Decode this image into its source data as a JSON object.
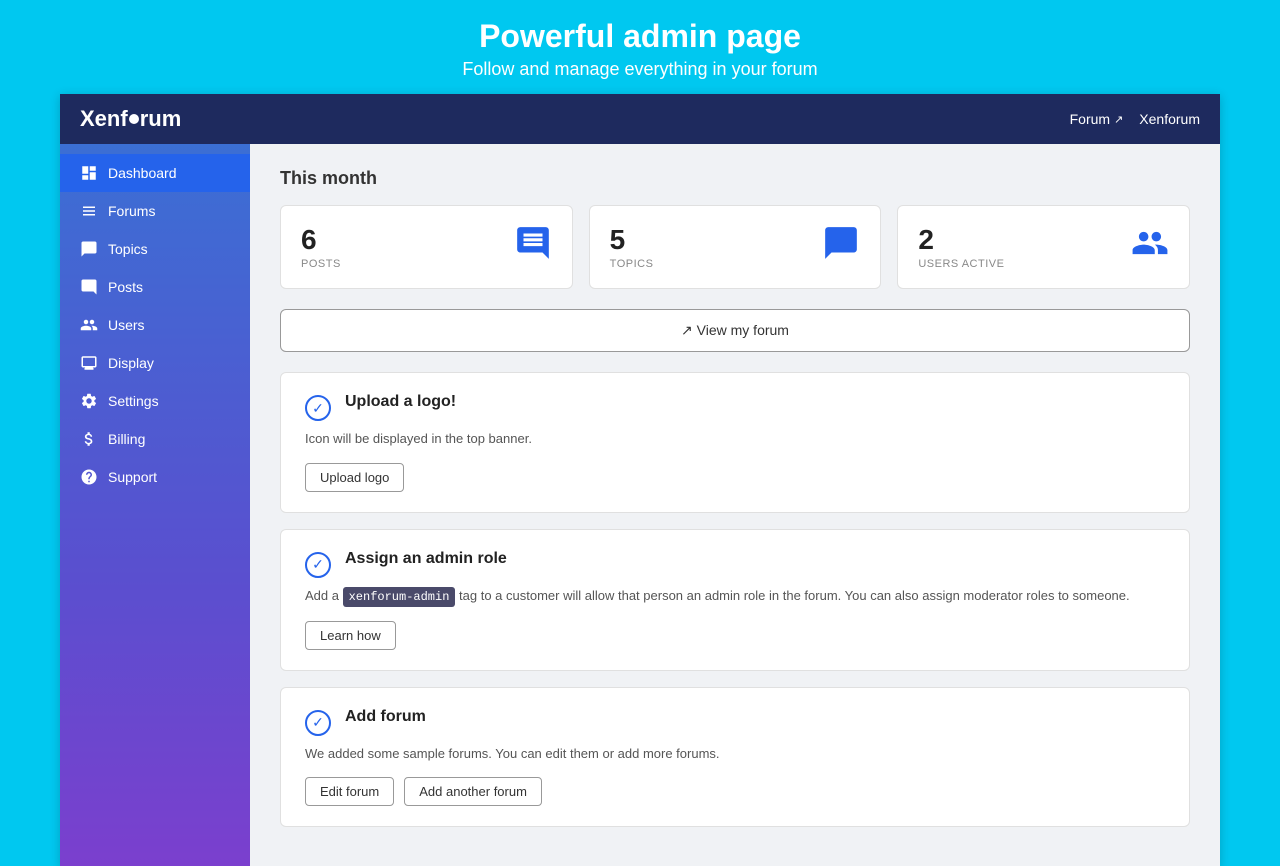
{
  "topBanner": {
    "title": "Powerful admin page",
    "subtitle": "Follow and manage everything in your forum"
  },
  "navbar": {
    "logo": "Xenforum",
    "rightLinks": [
      {
        "label": "Forum",
        "hasExternalIcon": true
      },
      {
        "label": "Xenforum"
      }
    ]
  },
  "sidebar": {
    "items": [
      {
        "id": "dashboard",
        "label": "Dashboard",
        "active": true
      },
      {
        "id": "forums",
        "label": "Forums",
        "active": false
      },
      {
        "id": "topics",
        "label": "Topics",
        "active": false
      },
      {
        "id": "posts",
        "label": "Posts",
        "active": false
      },
      {
        "id": "users",
        "label": "Users",
        "active": false
      },
      {
        "id": "display",
        "label": "Display",
        "active": false
      },
      {
        "id": "settings",
        "label": "Settings",
        "active": false
      },
      {
        "id": "billing",
        "label": "Billing",
        "active": false
      },
      {
        "id": "support",
        "label": "Support",
        "active": false
      }
    ]
  },
  "main": {
    "sectionTitle": "This month",
    "stats": [
      {
        "number": "6",
        "label": "POSTS"
      },
      {
        "number": "5",
        "label": "TOPICS"
      },
      {
        "number": "2",
        "label": "USERS ACTIVE"
      }
    ],
    "viewForumButton": "View my forum",
    "tasks": [
      {
        "id": "upload-logo",
        "title": "Upload a logo!",
        "description": "Icon will be displayed in the top banner.",
        "buttonLabel": "Upload logo",
        "hasTag": false
      },
      {
        "id": "assign-admin",
        "title": "Assign an admin role",
        "descriptionBefore": "Add a ",
        "tag": "xenforum-admin",
        "descriptionAfter": " tag to a customer will allow that person an admin role in the forum. You can also assign moderator roles to someone.",
        "buttonLabel": "Learn how",
        "hasTag": true
      },
      {
        "id": "add-forum",
        "title": "Add forum",
        "description": "We added some sample forums. You can edit them or add more forums.",
        "buttonLabel": "Edit forum",
        "buttonLabel2": "Add another forum",
        "hasTag": false,
        "hasSecondButton": true
      }
    ]
  }
}
